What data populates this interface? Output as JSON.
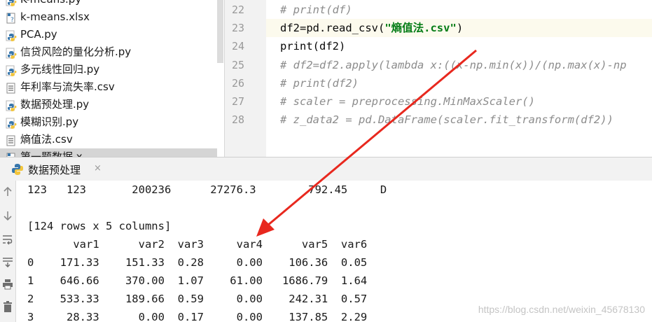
{
  "project_tree": {
    "items": [
      {
        "label": "K-means.py",
        "icon": "python-file-icon"
      },
      {
        "label": "k-means.xlsx",
        "icon": "unknown-file-icon"
      },
      {
        "label": "PCA.py",
        "icon": "python-file-icon"
      },
      {
        "label": "信贷风险的量化分析.py",
        "icon": "python-file-icon"
      },
      {
        "label": "多元线性回归.py",
        "icon": "python-file-icon"
      },
      {
        "label": "年利率与流失率.csv",
        "icon": "text-file-icon"
      },
      {
        "label": "数据预处理.py",
        "icon": "python-file-icon"
      },
      {
        "label": "模糊识别.py",
        "icon": "python-file-icon"
      },
      {
        "label": "熵值法.csv",
        "icon": "text-file-icon"
      },
      {
        "label": "第一题数据.x",
        "icon": "unknown-file-icon"
      }
    ]
  },
  "editor": {
    "line_numbers": [
      "22",
      "23",
      "24",
      "25",
      "26",
      "27",
      "28"
    ],
    "lines": [
      [
        {
          "t": "# print(df)",
          "c": "comment"
        }
      ],
      [
        {
          "t": "df2=pd.read_csv(",
          "c": "plain"
        },
        {
          "t": "\"熵值法.csv\"",
          "c": "str"
        },
        {
          "t": ")",
          "c": "plain"
        }
      ],
      [
        {
          "t": "print(df2)",
          "c": "plain"
        }
      ],
      [
        {
          "t": "# df2=df2.apply(lambda x:((x-np.min(x))/(np.max(x)-np",
          "c": "comment"
        }
      ],
      [
        {
          "t": "# print(df2)",
          "c": "comment"
        }
      ],
      [
        {
          "t": "# scaler = preprocessing.MinMaxScaler()",
          "c": "comment"
        }
      ],
      [
        {
          "t": "# z_data2 = pd.DataFrame(scaler.fit_transform(df2))",
          "c": "comment"
        }
      ]
    ]
  },
  "run_panel": {
    "tab_label": "数据预处理",
    "close_glyph": "×",
    "console_lines": [
      "123   123       200236      27276.3        792.45     D",
      "",
      "[124 rows x 5 columns]",
      "       var1      var2  var3     var4      var5  var6",
      "0    171.33    151.33  0.28     0.00    106.36  0.05",
      "1    646.66    370.00  1.07    61.00   1686.79  1.64",
      "2    533.33    189.66  0.59     0.00    242.31  0.57",
      "3     28.33      0.00  0.17     0.00    137.85  2.29"
    ]
  },
  "toolbar_icons": [
    "up-arrow-icon",
    "down-arrow-icon",
    "soft-wrap-icon",
    "scroll-to-end-icon",
    "print-icon",
    "trash-icon"
  ],
  "watermark": "https://blog.csdn.net/weixin_45678130",
  "colors": {
    "python_blue": "#3776ab",
    "python_yellow": "#f2c53d",
    "annotation_red": "#e8281e",
    "comment": "#8c8c8c",
    "string": "#067d17"
  }
}
